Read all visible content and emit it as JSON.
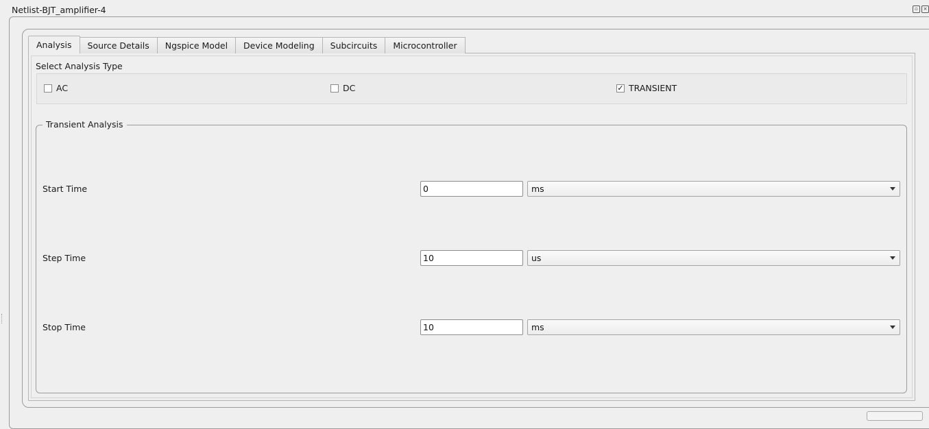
{
  "window": {
    "title": "Netlist-BJT_amplifier-4",
    "float_icon": "float-icon",
    "close_icon": "close-icon"
  },
  "tabs": [
    {
      "label": "Analysis",
      "active": true
    },
    {
      "label": "Source Details",
      "active": false
    },
    {
      "label": "Ngspice Model",
      "active": false
    },
    {
      "label": "Device Modeling",
      "active": false
    },
    {
      "label": "Subcircuits",
      "active": false
    },
    {
      "label": "Microcontroller",
      "active": false
    }
  ],
  "analysis": {
    "section_label": "Select Analysis Type",
    "options": [
      {
        "label": "AC",
        "checked": false
      },
      {
        "label": "DC",
        "checked": false
      },
      {
        "label": "TRANSIENT",
        "checked": true
      }
    ]
  },
  "transient": {
    "group_title": "Transient Analysis",
    "rows": [
      {
        "label": "Start Time",
        "value": "0",
        "unit": "ms"
      },
      {
        "label": "Step Time",
        "value": "10",
        "unit": "us"
      },
      {
        "label": "Stop Time",
        "value": "10",
        "unit": "ms"
      }
    ]
  }
}
